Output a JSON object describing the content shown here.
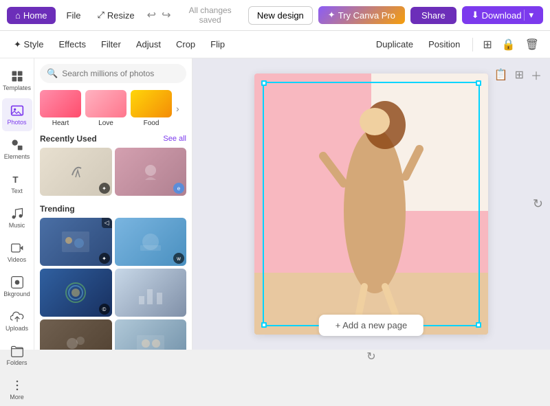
{
  "topbar": {
    "home_label": "Home",
    "file_label": "File",
    "resize_label": "Resize",
    "saved_text": "All changes saved",
    "new_design_label": "New design",
    "try_canva_label": "Try Canva Pro",
    "share_label": "Share",
    "download_label": "Download"
  },
  "toolbar2": {
    "style_label": "Style",
    "effects_label": "Effects",
    "filter_label": "Filter",
    "adjust_label": "Adjust",
    "crop_label": "Crop",
    "flip_label": "Flip",
    "duplicate_label": "Duplicate",
    "position_label": "Position"
  },
  "sidebar": {
    "items": [
      {
        "label": "Templates",
        "icon": "grid"
      },
      {
        "label": "Photos",
        "icon": "image"
      },
      {
        "label": "Elements",
        "icon": "shapes"
      },
      {
        "label": "Text",
        "icon": "text"
      },
      {
        "label": "Music",
        "icon": "music"
      },
      {
        "label": "Videos",
        "icon": "video"
      },
      {
        "label": "Bkground",
        "icon": "background"
      },
      {
        "label": "Uploads",
        "icon": "upload"
      },
      {
        "label": "Folders",
        "icon": "folder"
      },
      {
        "label": "More",
        "icon": "more"
      }
    ]
  },
  "photos_panel": {
    "search_placeholder": "Search millions of photos",
    "categories": [
      "Heart",
      "Love",
      "Food"
    ],
    "recently_used_title": "Recently Used",
    "see_all_label": "See all",
    "trending_title": "Trending"
  },
  "canvas": {
    "add_page_label": "+ Add a new page"
  }
}
